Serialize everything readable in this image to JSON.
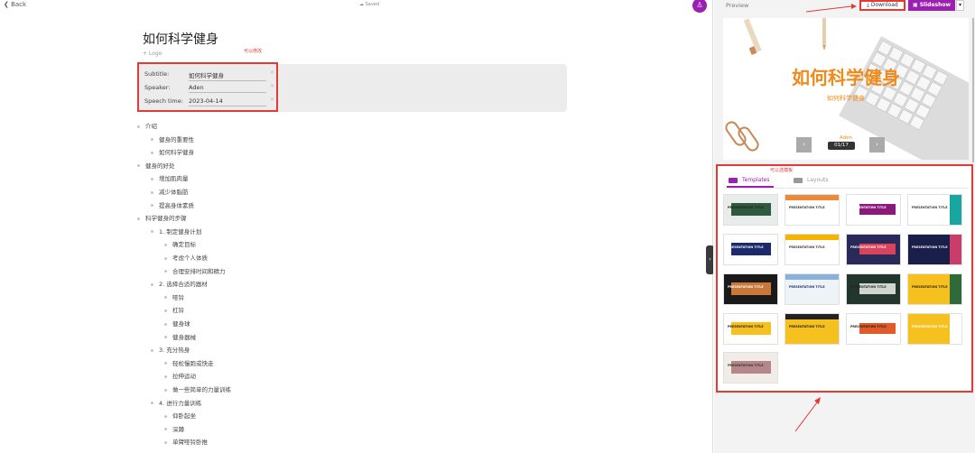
{
  "topbar": {
    "back_label": "❮ Back",
    "saved_label": "☁ Saved",
    "avatar_glyph": "♙"
  },
  "editor": {
    "title": "如何科学健身",
    "logo_link": "+ Logo",
    "annotation_editable": "可以修改",
    "meta": [
      {
        "label": "Subtitle:",
        "value": "如何科学健身"
      },
      {
        "label": "Speaker:",
        "value": "Aden"
      },
      {
        "label": "Speech time:",
        "value": "2023-04-14"
      }
    ],
    "outline": [
      {
        "level": 0,
        "text": "介绍"
      },
      {
        "level": 1,
        "text": "健身的重要性"
      },
      {
        "level": 1,
        "text": "如何科学健身"
      },
      {
        "level": 0,
        "text": "健身的好处"
      },
      {
        "level": 1,
        "text": "增加肌肉量"
      },
      {
        "level": 1,
        "text": "减少体脂肪"
      },
      {
        "level": 1,
        "text": "提高身体素质"
      },
      {
        "level": 0,
        "text": "科学健身的步骤"
      },
      {
        "level": 1,
        "text": "1. 制定健身计划"
      },
      {
        "level": 2,
        "text": "确定目标"
      },
      {
        "level": 2,
        "text": "考虑个人体质"
      },
      {
        "level": 2,
        "text": "合理安排时间和精力"
      },
      {
        "level": 1,
        "text": "2. 选择合适的器材"
      },
      {
        "level": 2,
        "text": "哑铃"
      },
      {
        "level": 2,
        "text": "杠铃"
      },
      {
        "level": 2,
        "text": "健身球"
      },
      {
        "level": 2,
        "text": "健身器械"
      },
      {
        "level": 1,
        "text": "3. 充分热身"
      },
      {
        "level": 2,
        "text": "轻松慢跑或快走"
      },
      {
        "level": 2,
        "text": "拉伸运动"
      },
      {
        "level": 2,
        "text": "做一些简单的力量训练"
      },
      {
        "level": 1,
        "text": "4. 进行力量训练"
      },
      {
        "level": 2,
        "text": "仰卧起坐"
      },
      {
        "level": 2,
        "text": "深蹲"
      },
      {
        "level": 2,
        "text": "单臂哑铃卧推"
      },
      {
        "level": 2,
        "text": "俯卧撑"
      }
    ]
  },
  "preview": {
    "label": "Preview",
    "download_label": "⤓ Download",
    "slideshow_label": "▣ Slideshow",
    "caret": "▾",
    "slide_title": "如何科学健身",
    "slide_subtitle": "如何科学健身",
    "slide_speaker": "Aden",
    "page_indicator": "01/17",
    "prev": "‹",
    "next": "›"
  },
  "templates": {
    "annotation_selectable": "可以选模板",
    "tab_templates": "Templates",
    "tab_layouts": "Layouts",
    "thumb_text": "PRESENTATION TITLE",
    "items": [
      {
        "bg": "#e8ecea",
        "band": "#2f5a3e",
        "text": "#222"
      },
      {
        "bg": "#ffffff",
        "band": "#e98a3c",
        "text": "#333"
      },
      {
        "bg": "#ffffff",
        "band": "#8a1b7a",
        "text": "#ffffff"
      },
      {
        "bg": "#ffffff",
        "band": "#1aa6a0",
        "text": "#333"
      },
      {
        "bg": "#ffffff",
        "band": "#1a2a6c",
        "text": "#ffffff"
      },
      {
        "bg": "#ffffff",
        "band": "#f4b400",
        "text": "#333"
      },
      {
        "bg": "#2a2a5a",
        "band": "#d8445c",
        "text": "#ffffff"
      },
      {
        "bg": "#1a1f4a",
        "band": "#c93d6a",
        "text": "#ffffff"
      },
      {
        "bg": "#1a1a1a",
        "band": "#c9783a",
        "text": "#ffffff"
      },
      {
        "bg": "#eef3f8",
        "band": "#8ab2d8",
        "text": "#1a2a6c"
      },
      {
        "bg": "#23362e",
        "band": "#cfd6cf",
        "text": "#222"
      },
      {
        "bg": "#f6c01e",
        "band": "#2f6b3a",
        "text": "#222"
      },
      {
        "bg": "#ffffff",
        "band": "#f6c01e",
        "text": "#222"
      },
      {
        "bg": "#f6c01e",
        "band": "#222222",
        "text": "#222"
      },
      {
        "bg": "#ffffff",
        "band": "#e05a2a",
        "text": "#222"
      },
      {
        "bg": "#f6c01e",
        "band": "#ffffff",
        "text": "#ffffff"
      },
      {
        "bg": "#f1ece8",
        "band": "#b4888a",
        "text": "#333"
      }
    ]
  },
  "colors": {
    "accent": "#9b1fb0",
    "annotation": "#e53935",
    "slide_title": "#f08a1a"
  }
}
